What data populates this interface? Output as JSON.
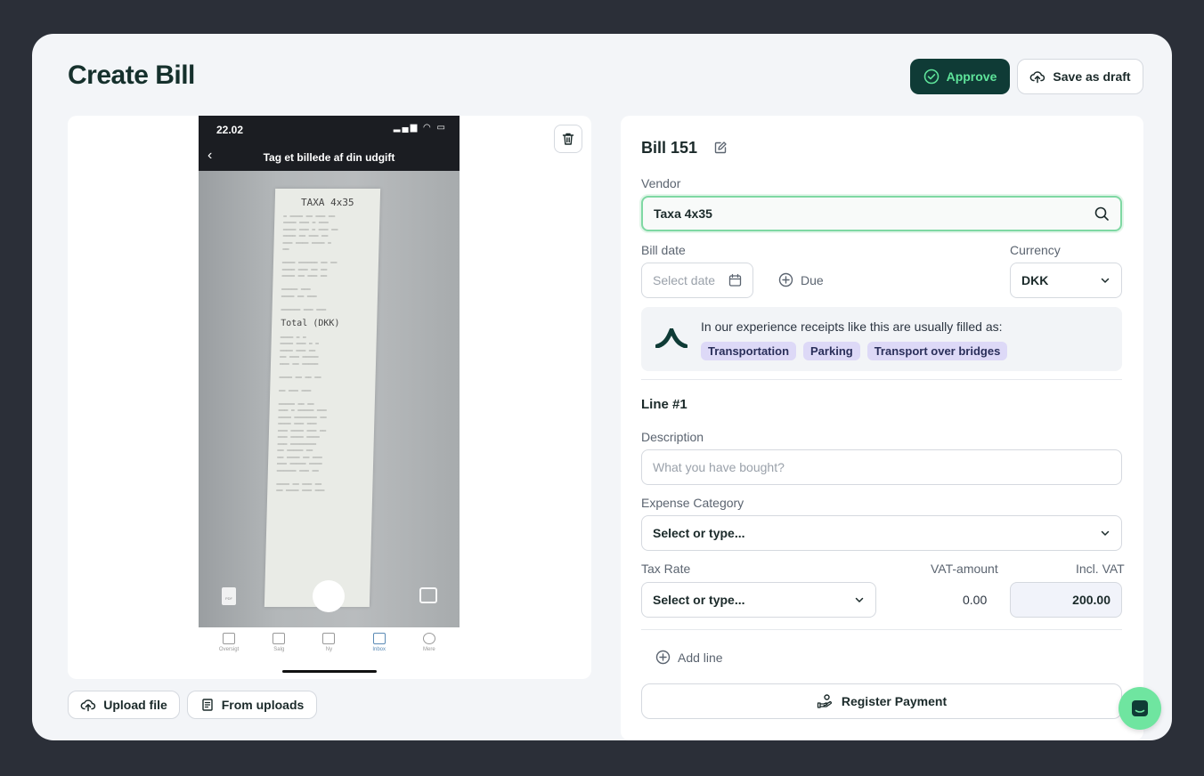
{
  "page": {
    "title": "Create Bill"
  },
  "header": {
    "approve_label": "Approve",
    "save_draft_label": "Save as draft"
  },
  "preview": {
    "phone": {
      "time": "22.02",
      "screen_title": "Tag et billede af din udgift",
      "receipt_heading": "TAXA 4x35",
      "receipt_total": "Total (DKK)",
      "nav": [
        {
          "label": "Oversigt",
          "icon": "chart-icon"
        },
        {
          "label": "Salg",
          "icon": "document-icon"
        },
        {
          "label": "Ny",
          "icon": "plus-square-icon"
        },
        {
          "label": "Inbox",
          "icon": "inbox-icon"
        },
        {
          "label": "Mere",
          "icon": "more-icon"
        }
      ]
    },
    "upload_label": "Upload file",
    "from_uploads_label": "From uploads"
  },
  "form": {
    "bill_title": "Bill 151",
    "vendor_label": "Vendor",
    "vendor_value": "Taxa 4x35",
    "bill_date_label": "Bill date",
    "bill_date_placeholder": "Select date",
    "due_label": "Due",
    "currency_label": "Currency",
    "currency_value": "DKK",
    "hint_text": "In our experience receipts like this are usually filled as:",
    "hint_chips": [
      "Transportation",
      "Parking",
      "Transport over bridges"
    ],
    "line_title": "Line #1",
    "description_label": "Description",
    "description_placeholder": "What you have bought?",
    "expense_category_label": "Expense Category",
    "expense_category_value": "Select or type...",
    "tax_rate_label": "Tax Rate",
    "tax_rate_value": "Select or type...",
    "vat_amount_label": "VAT-amount",
    "vat_amount_value": "0.00",
    "incl_vat_label": "Incl. VAT",
    "incl_vat_value": "200.00",
    "add_line_label": "Add line",
    "register_payment_label": "Register Payment"
  },
  "colors": {
    "brand_dark": "#0f3b36",
    "brand_green": "#5ee39a",
    "chip_bg": "#ddd9f7"
  }
}
